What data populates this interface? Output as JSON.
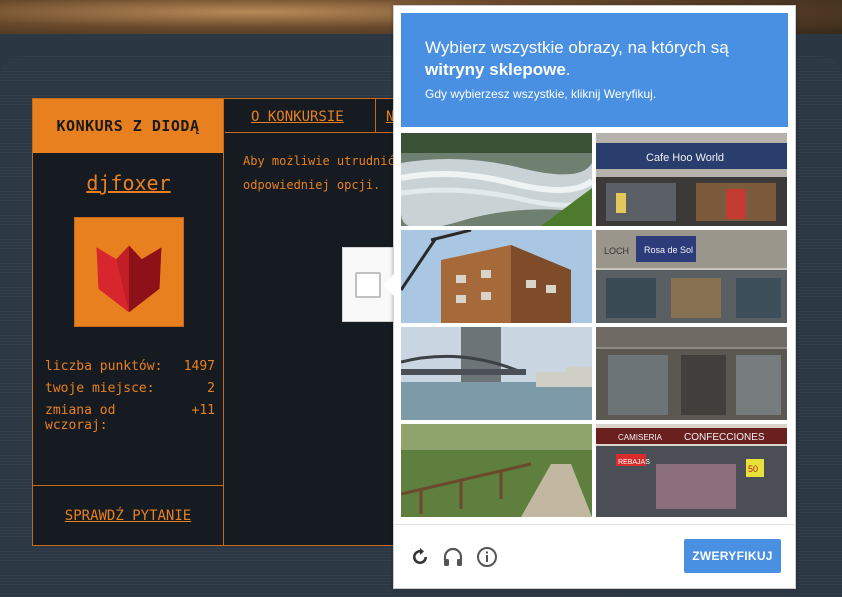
{
  "sidebar": {
    "heading": "KONKURS Z DIODĄ",
    "username": "djfoxer",
    "stats": [
      {
        "label": "liczba punktów:",
        "value": "1497"
      },
      {
        "label": "twoje miejsce:",
        "value": "2"
      },
      {
        "label": "zmiana od wczoraj:",
        "value": "+11"
      }
    ],
    "check_question": "SPRAWDŹ PYTANIE"
  },
  "tabs": {
    "about": "O KONKURSIE",
    "next": "N"
  },
  "main": {
    "line1": "Aby możliwie utrudnić ko",
    "line2": "odpowiedniej opcji."
  },
  "captcha": {
    "title_prefix": "Wybierz wszystkie obrazy, na których są",
    "title_bold": "witryny sklepowe",
    "title_suffix": ".",
    "subtitle": "Gdy wybierzesz wszystkie, kliknij Weryfikuj.",
    "tiles": [
      "river",
      "storefront-cafe",
      "building-crane",
      "storefront-loch",
      "bridge",
      "storefront-grey",
      "path-fence",
      "storefront-confecciones"
    ],
    "tile_text": {
      "cafe": "Cafe Hoo World",
      "loch": "LOCH",
      "rosa": "Rosa de Sol",
      "confecciones": "CONFECCIONES",
      "camiseria": "CAMISERIA",
      "rebajas": "REBAJAS",
      "price": "50"
    },
    "verify_label": "ZWERYFIKUJ",
    "icons": [
      "reload-icon",
      "headphones-icon",
      "info-icon"
    ]
  },
  "colors": {
    "accent": "#e8801f",
    "captcha_blue": "#4a90e2"
  }
}
